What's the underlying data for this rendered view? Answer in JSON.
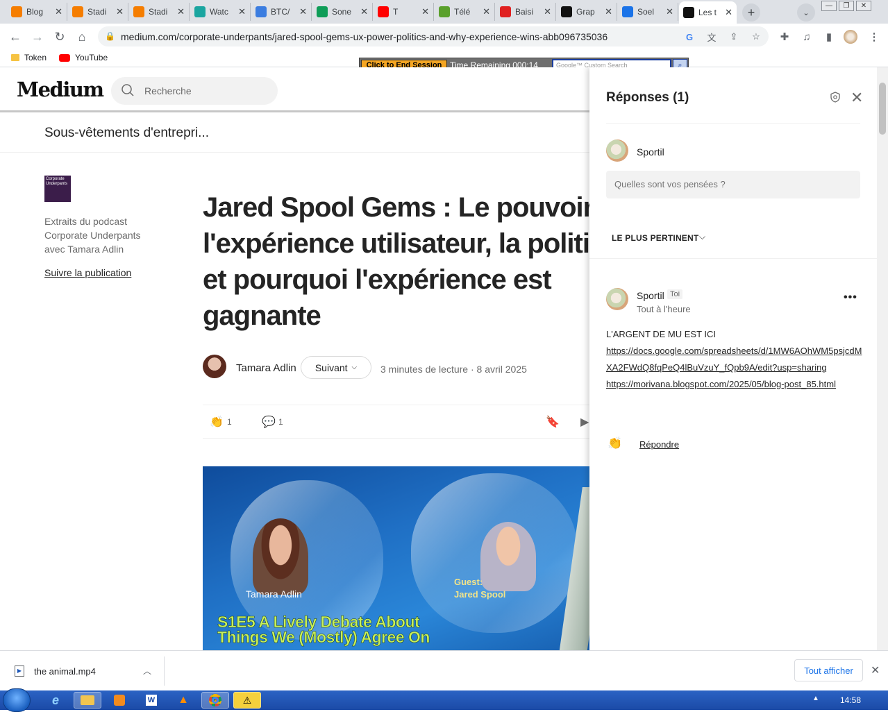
{
  "browser": {
    "tabs": [
      {
        "title": "Blog",
        "favicon": "blogger-icon",
        "color": "#f57d00"
      },
      {
        "title": "Stadi",
        "favicon": "blogger-icon",
        "color": "#f57d00"
      },
      {
        "title": "Stadi",
        "favicon": "blogger-icon",
        "color": "#f57d00"
      },
      {
        "title": "Watc",
        "favicon": "shirt-icon",
        "color": "#1aa5a0"
      },
      {
        "title": "BTC/",
        "favicon": "chart-icon",
        "color": "#3b7de0"
      },
      {
        "title": "Sone",
        "favicon": "sheets-plus-icon",
        "color": "#0f9d58"
      },
      {
        "title": "T",
        "favicon": "youtube-icon",
        "color": "#ff0000"
      },
      {
        "title": "Télé",
        "favicon": "download-arrow-icon",
        "color": "#5aa02c"
      },
      {
        "title": "Baisi",
        "favicon": "shop-icon",
        "color": "#e02020"
      },
      {
        "title": "Grap",
        "favicon": "medium-icon",
        "color": "#111111"
      },
      {
        "title": "Soel",
        "favicon": "user-icon",
        "color": "#1a73e8"
      },
      {
        "title": "Les t",
        "favicon": "medium-icon",
        "color": "#111111"
      }
    ],
    "url": "medium.com/corporate-underpants/jared-spool-gems-ux-power-politics-and-why-experience-wins-abb096735036",
    "bookmarks": [
      {
        "label": "Token",
        "icon": "folder-icon"
      },
      {
        "label": "YouTube",
        "icon": "youtube-icon"
      }
    ]
  },
  "session_bar": {
    "end_label": "Click to End Session",
    "time_label": "Time Remaining 000:14",
    "search_placeholder": "Google™ Custom Search"
  },
  "medium": {
    "logo": "Medium",
    "search_placeholder": "Recherche",
    "publication_name": "Sous-vêtements d'entrepri...",
    "publication_logo_text": "Corporate Underpants",
    "publication_desc": "Extraits du podcast Corporate Underpants avec Tamara Adlin",
    "follow_publication": "Suivre la publication",
    "article": {
      "title_lines": [
        "Jared Spool Gems : Le pouvoir de",
        "l'expérience utilisateur, la politique",
        "et pourquoi l'expérience est",
        "gagnante"
      ],
      "author": "Tamara Adlin",
      "follow_label": "Suivant",
      "read_time": "3 minutes de lecture",
      "date": "8 avril 2025",
      "claps": "1",
      "comments": "1"
    },
    "hero": {
      "host": "Tamara Adlin",
      "guest_label": "Guest:",
      "guest_name": "Jared Spool",
      "caption_line1": "S1E5 A Lively Debate About",
      "caption_line2": "Things We (Mostly) Agree On"
    }
  },
  "responses": {
    "title": "Réponses (1)",
    "composer_user": "Sportil",
    "composer_placeholder": "Quelles sont vos pensées ?",
    "sort_label": "LE PLUS PERTINENT",
    "comment": {
      "user": "Sportil",
      "badge": "Toi",
      "time": "Tout à l'heure",
      "text": "L'ARGENT DE MU EST ICI",
      "link1": "https://docs.google.com/spreadsheets/d/1MW6AOhWM5psjcdMXA2FWdQ8fqPeQ4lBuVzuY_fQpb9A/edit?usp=sharing",
      "link2": "https://morivana.blogspot.com/2025/05/blog-post_85.html",
      "reply_label": "Répondre"
    }
  },
  "downloads": {
    "file": "the animal.mp4",
    "show_all": "Tout afficher"
  },
  "taskbar": {
    "clock": "14:58"
  }
}
